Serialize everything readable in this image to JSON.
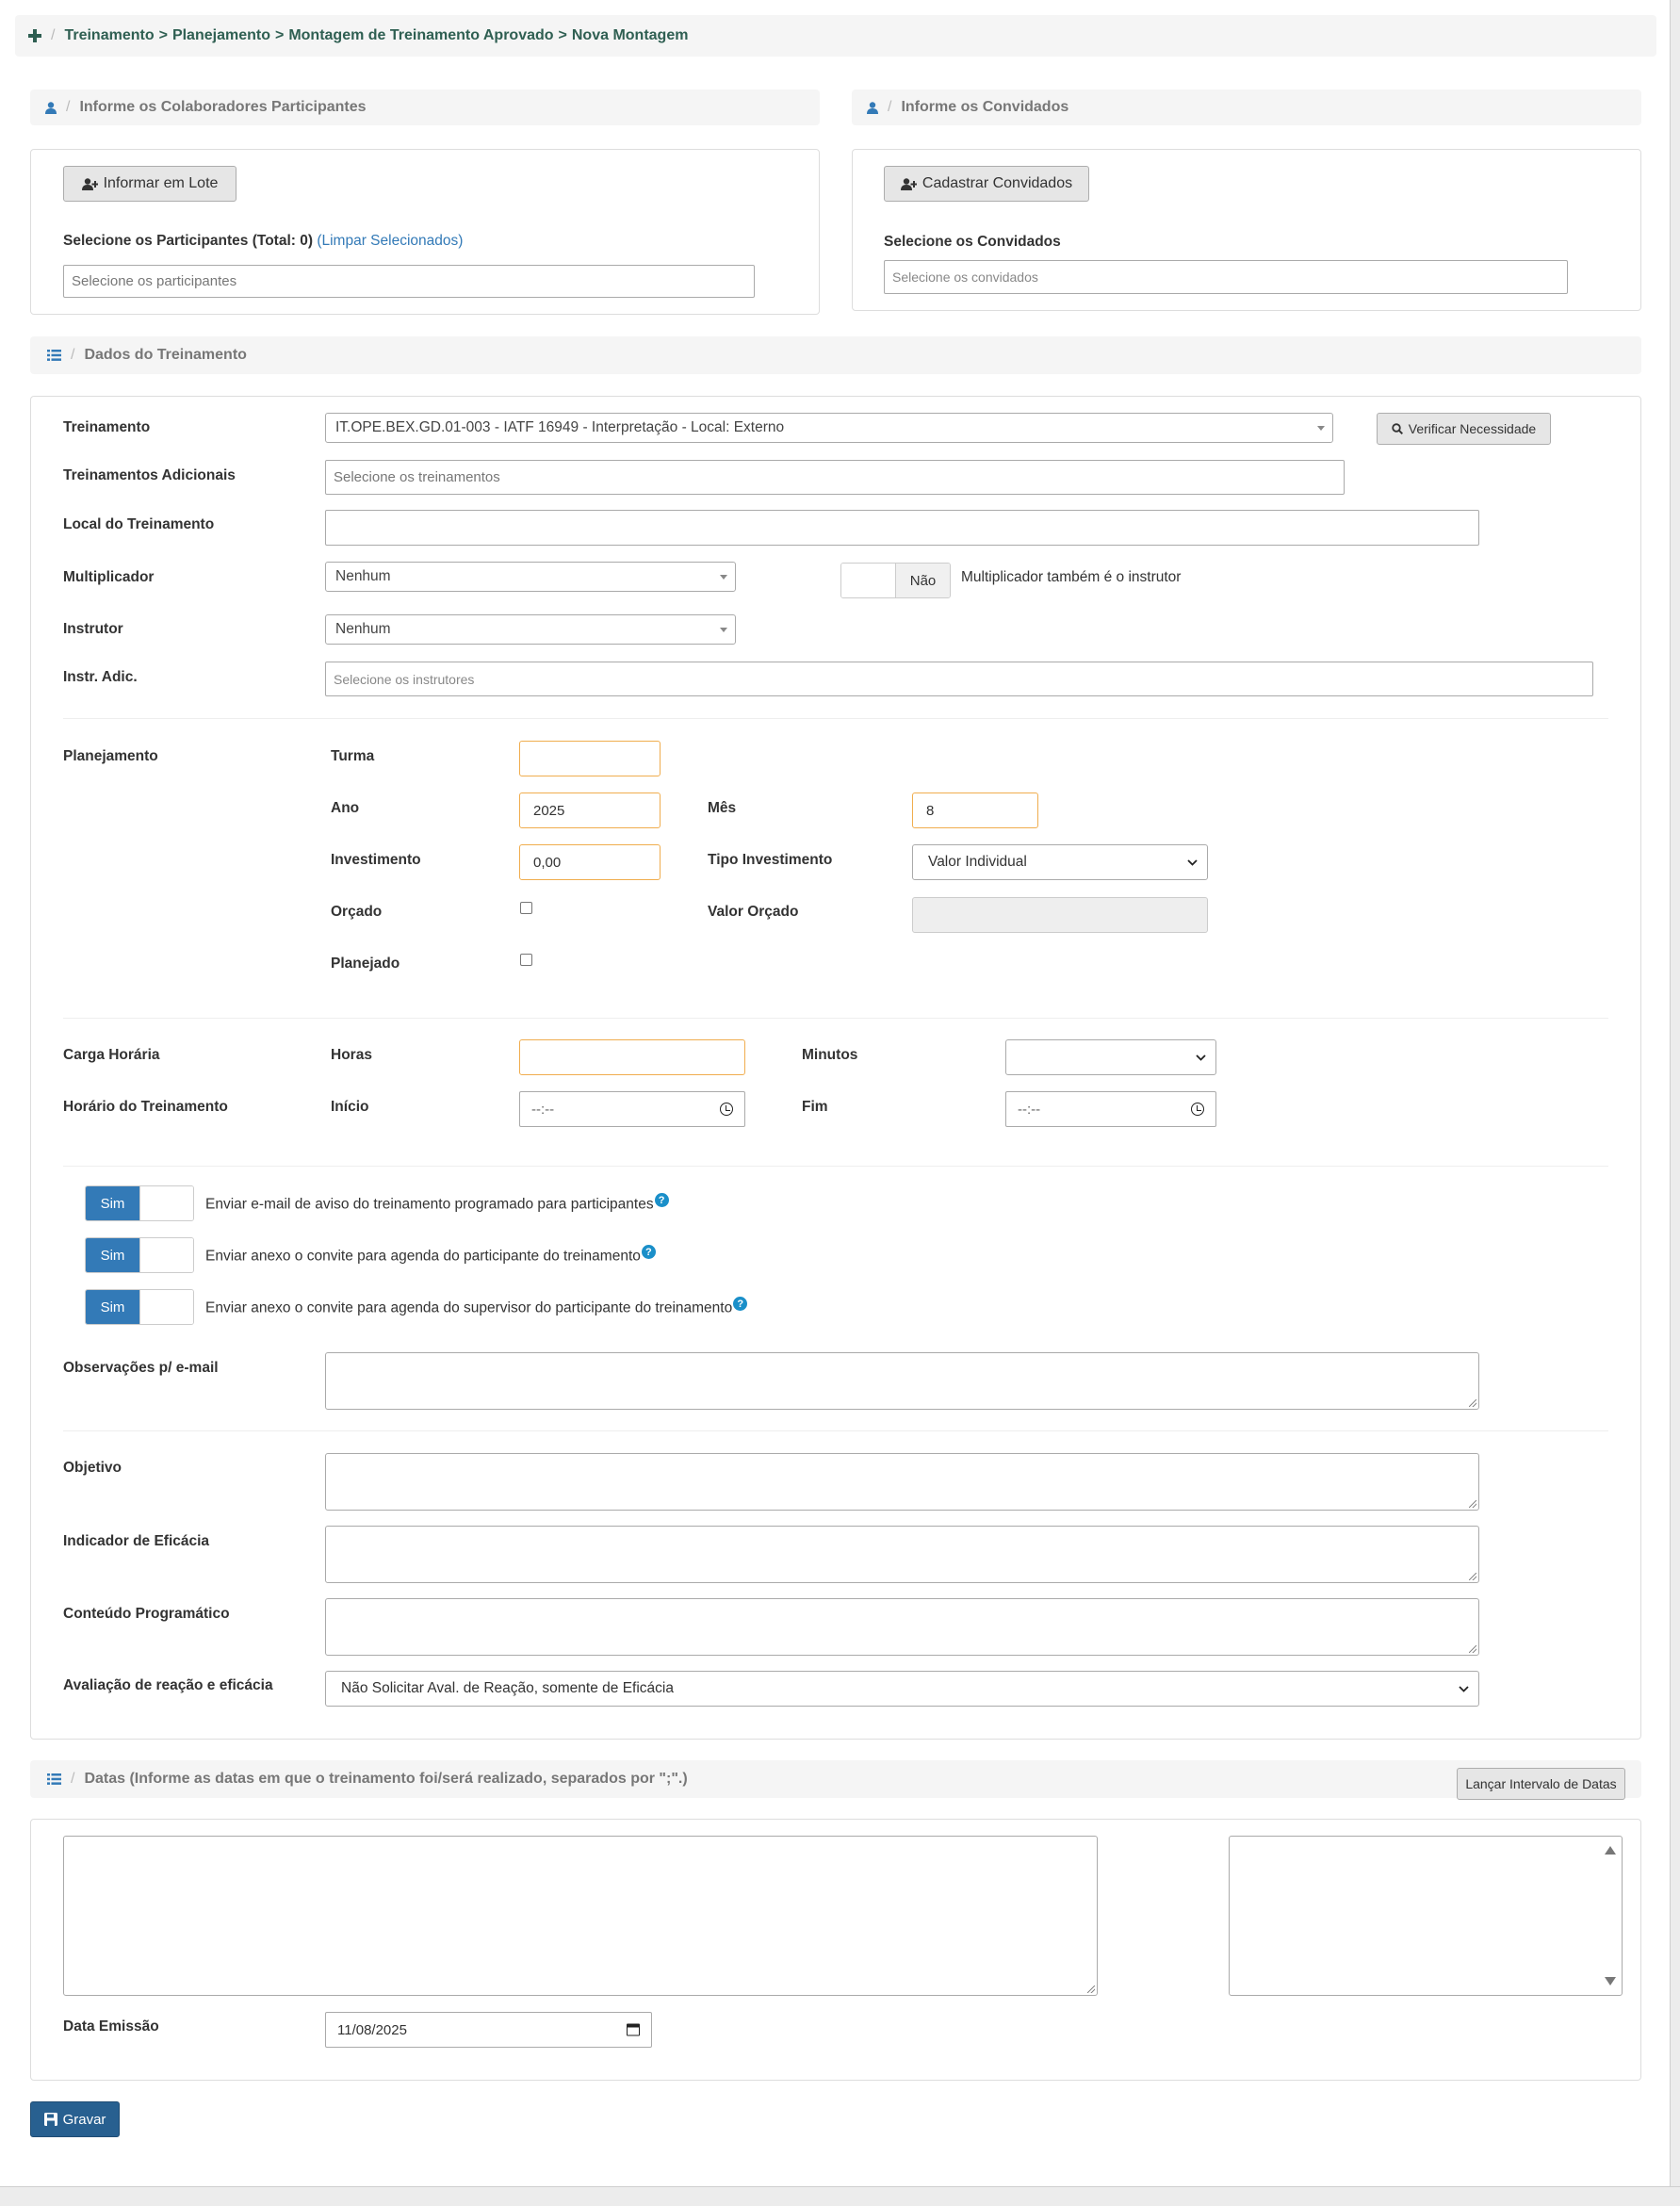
{
  "breadcrumb": {
    "items": [
      "Treinamento",
      "Planejamento",
      "Montagem de Treinamento Aprovado",
      "Nova Montagem"
    ],
    "separator": ">"
  },
  "participants": {
    "section_title": "Informe os Colaboradores Participantes",
    "batch_button": "Informar em Lote",
    "select_label": "Selecione os Participantes (Total: 0)",
    "clear_link": "(Limpar Selecionados)",
    "placeholder": "Selecione os participantes"
  },
  "guests": {
    "section_title": "Informe os Convidados",
    "register_button": "Cadastrar Convidados",
    "select_label": "Selecione os Convidados",
    "placeholder": "Selecione os convidados"
  },
  "training": {
    "section_title": "Dados do Treinamento",
    "treinamento_label": "Treinamento",
    "treinamento_value": "IT.OPE.BEX.GD.01-003 - IATF 16949 - Interpretação - Local: Externo",
    "verify_button": "Verificar Necessidade",
    "adicionais_label": "Treinamentos Adicionais",
    "adicionais_placeholder": "Selecione os treinamentos",
    "local_label": "Local do Treinamento",
    "local_value": "",
    "multiplicador_label": "Multiplicador",
    "multiplicador_value": "Nenhum",
    "mult_toggle_value": "Não",
    "mult_toggle_text": "Multiplicador também é o instrutor",
    "instrutor_label": "Instrutor",
    "instrutor_value": "Nenhum",
    "instr_adic_label": "Instr. Adic.",
    "instr_adic_placeholder": "Selecione os instrutores"
  },
  "planning": {
    "label": "Planejamento",
    "turma_label": "Turma",
    "turma_value": "",
    "ano_label": "Ano",
    "ano_value": "2025",
    "mes_label": "Mês",
    "mes_value": "8",
    "investimento_label": "Investimento",
    "investimento_value": "0,00",
    "tipo_label": "Tipo Investimento",
    "tipo_value": "Valor Individual",
    "orcado_label": "Orçado",
    "valor_orcado_label": "Valor Orçado",
    "planejado_label": "Planejado"
  },
  "schedule": {
    "carga_label": "Carga Horária",
    "horas_label": "Horas",
    "minutos_label": "Minutos",
    "horario_label": "Horário do Treinamento",
    "inicio_label": "Início",
    "inicio_value": "--:--",
    "fim_label": "Fim",
    "fim_value": "--:--"
  },
  "notifications": {
    "on_label": "Sim",
    "items": [
      "Enviar e-mail de aviso do treinamento programado para participantes",
      "Enviar anexo o convite para agenda do participante do treinamento",
      "Enviar anexo o convite para agenda do supervisor do participante do treinamento"
    ],
    "help_glyph": "?",
    "obs_label": "Observações p/ e-mail"
  },
  "details": {
    "objetivo_label": "Objetivo",
    "indicador_label": "Indicador de Eficácia",
    "conteudo_label": "Conteúdo Programático",
    "avaliacao_label": "Avaliação de reação e eficácia",
    "avaliacao_value": "Não Solicitar Aval. de Reação, somente de Eficácia"
  },
  "dates": {
    "section_title": "Datas (Informe as datas em que o treinamento foi/será realizado, separados por \";\".)",
    "range_button": "Lançar Intervalo de Datas",
    "emissao_label": "Data Emissão",
    "emissao_value": "11/08/2025"
  },
  "actions": {
    "save_button": "Gravar"
  },
  "colors": {
    "primary": "#337ab7",
    "save": "#286090",
    "breadcrumb": "#2f5f52",
    "warning_border": "#f0ad4e",
    "help": "#1a8fc9"
  }
}
